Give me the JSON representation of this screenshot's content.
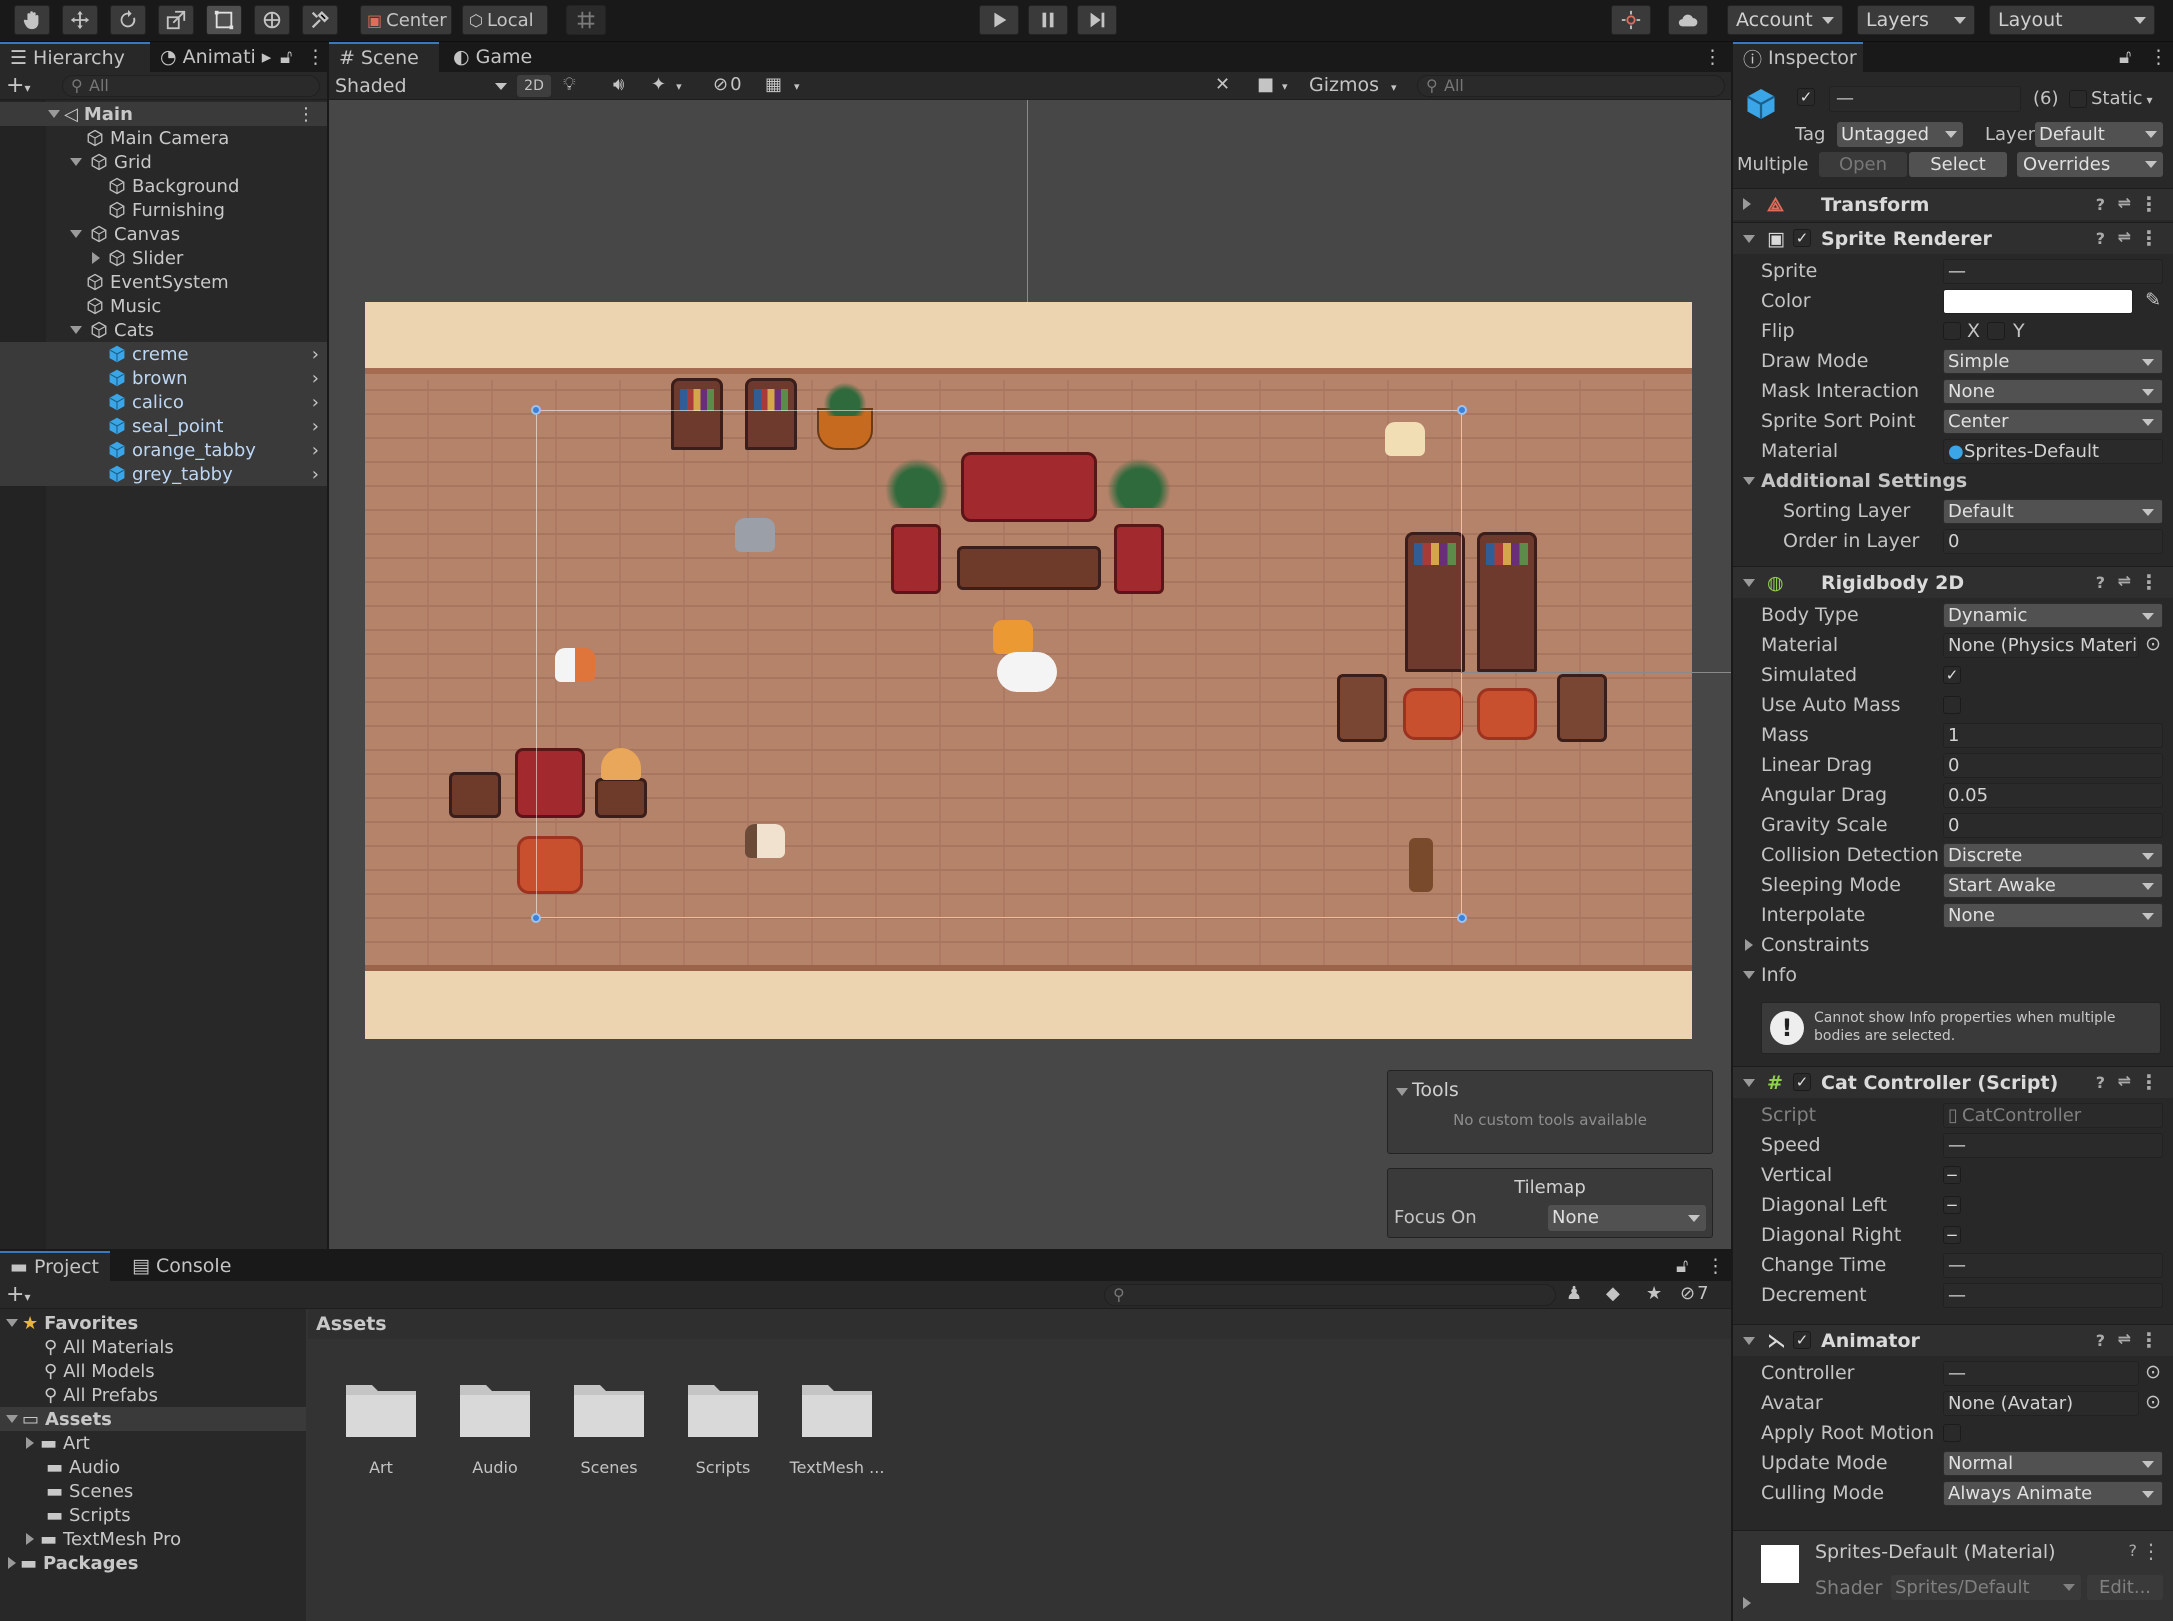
{
  "toolbar": {
    "pivot_label": "Center",
    "space_label": "Local",
    "account_label": "Account",
    "layers_label": "Layers",
    "layout_label": "Layout"
  },
  "hierarchy": {
    "tab_label": "Hierarchy",
    "anim_tab_label": "Animati",
    "search_placeholder": "All",
    "scene_name": "Main",
    "items": [
      {
        "label": "Main Camera",
        "depth": 1
      },
      {
        "label": "Grid",
        "depth": 1
      },
      {
        "label": "Background",
        "depth": 2
      },
      {
        "label": "Furnishing",
        "depth": 2
      },
      {
        "label": "Canvas",
        "depth": 1
      },
      {
        "label": "Slider",
        "depth": 2
      },
      {
        "label": "EventSystem",
        "depth": 1
      },
      {
        "label": "Music",
        "depth": 1
      },
      {
        "label": "Cats",
        "depth": 1
      },
      {
        "label": "creme",
        "depth": 2
      },
      {
        "label": "brown",
        "depth": 2
      },
      {
        "label": "calico",
        "depth": 2
      },
      {
        "label": "seal_point",
        "depth": 2
      },
      {
        "label": "orange_tabby",
        "depth": 2
      },
      {
        "label": "grey_tabby",
        "depth": 2
      }
    ]
  },
  "scene_view": {
    "scene_tab": "Scene",
    "game_tab": "Game",
    "shading": "Shaded",
    "mode_2d": "2D",
    "hidden_count": "0",
    "gizmos_label": "Gizmos",
    "search_placeholder": "All"
  },
  "overlays": {
    "tools_title": "Tools",
    "tools_message": "No custom tools available",
    "tilemap_title": "Tilemap",
    "focus_label": "Focus On",
    "focus_value": "None"
  },
  "project": {
    "project_tab": "Project",
    "console_tab": "Console",
    "hidden_count": "7",
    "favorites_label": "Favorites",
    "favorites": [
      "All Materials",
      "All Models",
      "All Prefabs"
    ],
    "assets_label": "Assets",
    "asset_folders": [
      "Art",
      "Audio",
      "Scenes",
      "Scripts",
      "TextMesh Pro"
    ],
    "packages_label": "Packages",
    "breadcrumb": "Assets",
    "grid_items": [
      "Art",
      "Audio",
      "Scenes",
      "Scripts",
      "TextMesh ..."
    ]
  },
  "inspector": {
    "tab_label": "Inspector",
    "name_value": "—",
    "count_label": "(6)",
    "static_label": "Static",
    "tag_label": "Tag",
    "tag_value": "Untagged",
    "layer_label": "Layer",
    "layer_value": "Default",
    "multiple_label": "Multiple",
    "open_label": "Open",
    "select_label": "Select",
    "overrides_label": "Overrides",
    "transform_title": "Transform",
    "sprite_renderer": {
      "title": "Sprite Renderer",
      "sprite_label": "Sprite",
      "sprite_value": "—",
      "color_label": "Color",
      "flip_label": "Flip",
      "flip_x": "X",
      "flip_y": "Y",
      "draw_mode_label": "Draw Mode",
      "draw_mode_value": "Simple",
      "mask_label": "Mask Interaction",
      "mask_value": "None",
      "sort_point_label": "Sprite Sort Point",
      "sort_point_value": "Center",
      "material_label": "Material",
      "material_value": "Sprites-Default",
      "additional_label": "Additional Settings",
      "sorting_layer_label": "Sorting Layer",
      "sorting_layer_value": "Default",
      "order_label": "Order in Layer",
      "order_value": "0"
    },
    "rigidbody": {
      "title": "Rigidbody 2D",
      "body_type_label": "Body Type",
      "body_type_value": "Dynamic",
      "material_label": "Material",
      "material_value": "None (Physics Materi",
      "simulated_label": "Simulated",
      "auto_mass_label": "Use Auto Mass",
      "mass_label": "Mass",
      "mass_value": "1",
      "linear_drag_label": "Linear Drag",
      "linear_drag_value": "0",
      "angular_drag_label": "Angular Drag",
      "angular_drag_value": "0.05",
      "gravity_label": "Gravity Scale",
      "gravity_value": "0",
      "collision_label": "Collision Detection",
      "collision_value": "Discrete",
      "sleeping_label": "Sleeping Mode",
      "sleeping_value": "Start Awake",
      "interpolate_label": "Interpolate",
      "interpolate_value": "None",
      "constraints_label": "Constraints",
      "info_label": "Info",
      "info_message": "Cannot show Info properties when multiple bodies are selected."
    },
    "cat_controller": {
      "title": "Cat Controller (Script)",
      "script_label": "Script",
      "script_value": "CatController",
      "speed_label": "Speed",
      "speed_value": "—",
      "vertical_label": "Vertical",
      "diag_left_label": "Diagonal Left",
      "diag_right_label": "Diagonal Right",
      "change_time_label": "Change Time",
      "change_time_value": "—",
      "decrement_label": "Decrement",
      "decrement_value": "—"
    },
    "animator": {
      "title": "Animator",
      "controller_label": "Controller",
      "controller_value": "—",
      "avatar_label": "Avatar",
      "avatar_value": "None (Avatar)",
      "root_motion_label": "Apply Root Motion",
      "update_mode_label": "Update Mode",
      "update_mode_value": "Normal",
      "culling_label": "Culling Mode",
      "culling_value": "Always Animate"
    },
    "material_footer": {
      "title": "Sprites-Default (Material)",
      "shader_label": "Shader",
      "shader_value": "Sprites/Default",
      "edit_label": "Edit..."
    }
  },
  "colors": {
    "accent": "#3a79bb",
    "selection": "#3e5f8a",
    "panel": "#282828"
  }
}
